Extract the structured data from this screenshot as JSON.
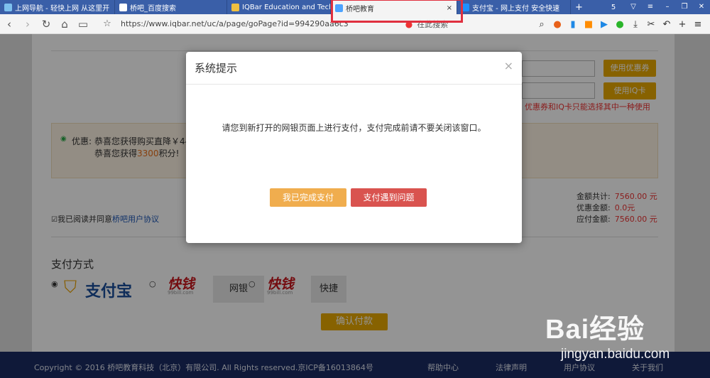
{
  "browser": {
    "tabs": [
      {
        "title": "上网导航 - 轻快上网 从这里开",
        "icon_color": "#7ec0ee"
      },
      {
        "title": "桥吧_百度搜索",
        "icon_color": "#ffffff"
      },
      {
        "title": "IQBar Education and Tech",
        "icon_color": "#f0c040"
      },
      {
        "title": "桥吧教育",
        "icon_color": "#4da3ff"
      },
      {
        "title": "支付宝 - 网上支付 安全快速",
        "icon_color": "#1e90ff"
      }
    ],
    "active_tab_close": "×",
    "new_tab": "+",
    "tab_count": "5",
    "url": "https://www.iqbar.net/uc/a/page/goPage?id=994290aa6c3",
    "search_placeholder": "在此搜索"
  },
  "order": {
    "coupon_button": "使用优惠券",
    "iq_card_button": "使用IQ卡",
    "coupon_note": "优惠券和IQ卡只能选择其中一种使用",
    "discount_label": "优惠:",
    "discount_line1": "恭喜您获得购买直降￥444",
    "discount_line2_prefix": "恭喜您获得",
    "discount_points": "3300",
    "discount_line2_suffix": "积分!",
    "total_label": "金额共计:",
    "total_value": "7560.00 元",
    "coupon_amount_label": "优惠金额:",
    "coupon_amount_value": "0.0元",
    "payable_label": "应付金额:",
    "payable_value": "7560.00 元",
    "agree_text": "我已阅读并同意",
    "agree_link": "桥吧用户协议",
    "pay_method_title": "支付方式",
    "methods": [
      {
        "name": "支付宝"
      },
      {
        "name": "快钱",
        "sub": "99bill.com"
      },
      {
        "name": "网银"
      },
      {
        "name": "快钱",
        "sub": "99bill.com"
      },
      {
        "name": "快捷"
      }
    ],
    "confirm_button": "确认付款"
  },
  "modal": {
    "title": "系统提示",
    "close": "×",
    "message": "请您到新打开的网银页面上进行支付，支付完成前请不要关闭该窗口。",
    "done_button": "我已完成支付",
    "problem_button": "支付遇到问题"
  },
  "footer": {
    "copyright": "Copyright © 2016 桥吧教育科技（北京）有限公司. All Rights reserved.京ICP备16013864号",
    "links": [
      "帮助中心",
      "法律声明",
      "用户协议",
      "关于我们"
    ]
  },
  "watermark": {
    "brand": "Bai经验",
    "url": "jingyan.baidu.com"
  }
}
